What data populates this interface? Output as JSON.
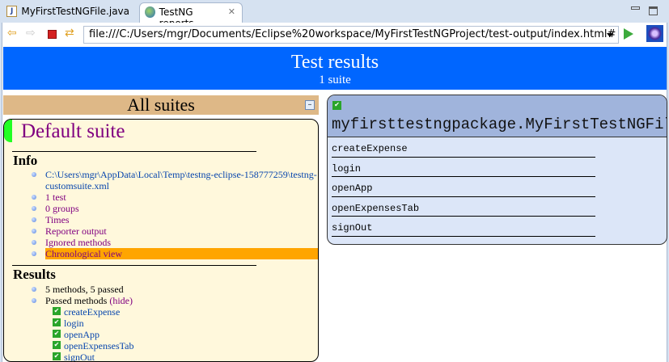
{
  "tabs": [
    {
      "label": "MyFirstTestNGFile.java",
      "icon": "java-file-icon"
    },
    {
      "label": "TestNG reports",
      "icon": "globe-icon",
      "active": true
    }
  ],
  "toolbar": {
    "url": "file:///C:/Users/mgr/Documents/Eclipse%20workspace/MyFirstTestNGProject/test-output/index.html#"
  },
  "banner": {
    "title": "Test results",
    "subtitle": "1 suite"
  },
  "left": {
    "header": "All suites",
    "suite_name": "Default suite",
    "info_heading": "Info",
    "info_items": [
      {
        "label": "C:\\Users\\mgr\\AppData\\Local\\Temp\\testng-eclipse-158777259\\testng-customsuite.xml",
        "style": "link"
      },
      {
        "label": "1 test",
        "style": "visited"
      },
      {
        "label": "0 groups",
        "style": "visited"
      },
      {
        "label": "Times",
        "style": "visited"
      },
      {
        "label": "Reporter output",
        "style": "visited"
      },
      {
        "label": "Ignored methods",
        "style": "visited"
      },
      {
        "label": "Chronological view",
        "style": "highlighted"
      }
    ],
    "results_heading": "Results",
    "summary": "5 methods, 5 passed",
    "passed_label": "Passed methods",
    "hide_label": "(hide)",
    "passed_methods": [
      "createExpense",
      "login",
      "openApp",
      "openExpensesTab",
      "signOut"
    ]
  },
  "right": {
    "class_name": "myfirsttestngpackage.MyFirstTestNGFile",
    "methods": [
      "createExpense",
      "login",
      "openApp",
      "openExpensesTab",
      "signOut"
    ]
  },
  "colors": {
    "banner": "#0066ff",
    "suites_header": "#deb887",
    "suite_bg": "#fff8dc",
    "highlight": "#ffa500",
    "class_header": "#a0b4dc",
    "class_body": "#dce6f8"
  }
}
